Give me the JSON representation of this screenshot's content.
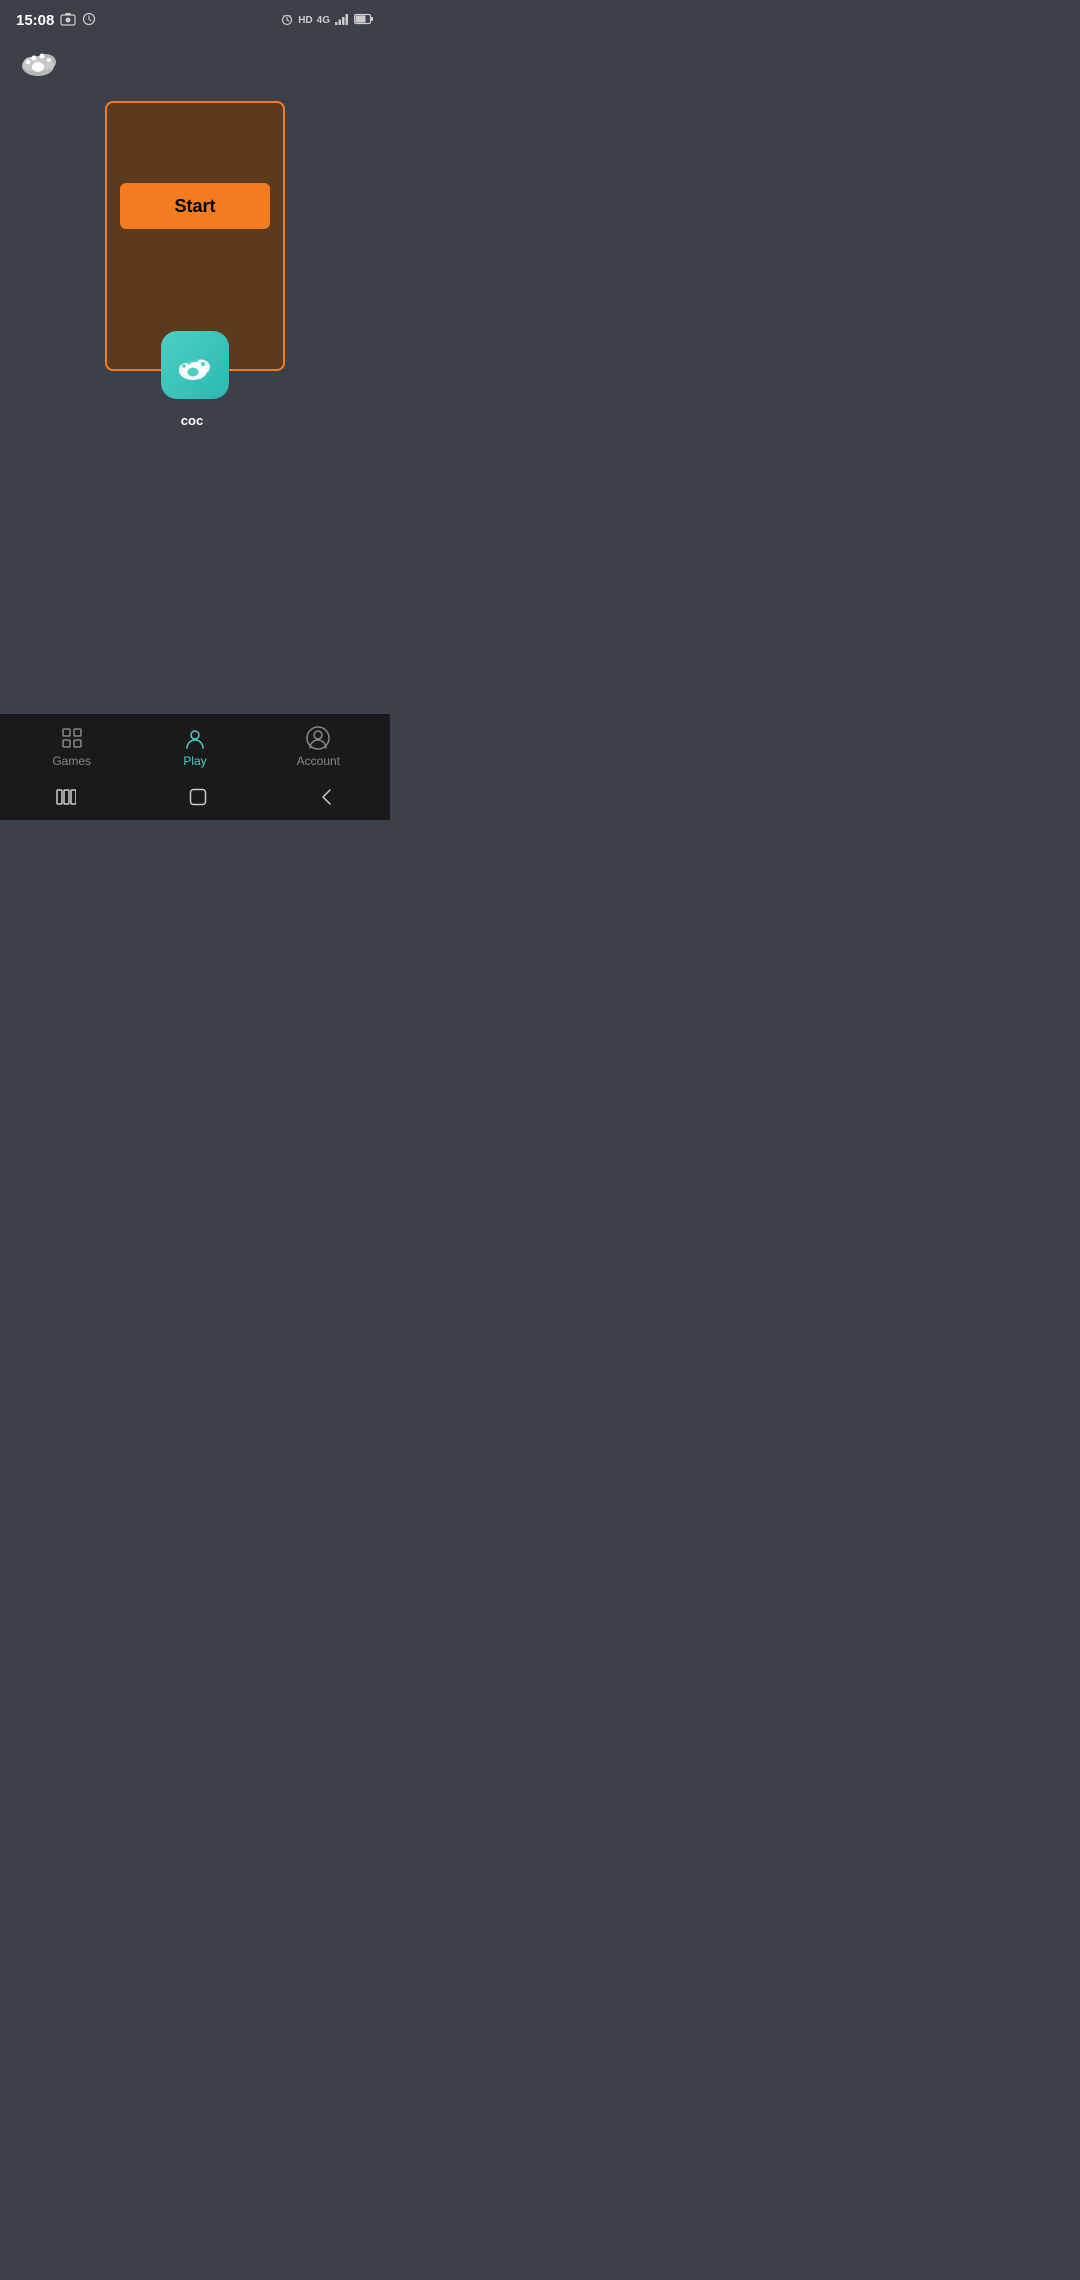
{
  "statusBar": {
    "time": "15:08",
    "icons": [
      "photo",
      "history"
    ],
    "rightIcons": [
      "alarm",
      "hd",
      "4g",
      "signal",
      "battery"
    ]
  },
  "header": {
    "appIconLabel": "paw-cloud"
  },
  "gameCard": {
    "startButtonLabel": "Start",
    "gameTitle": "coc",
    "borderColor": "#f47c20",
    "backgroundColor": "#5c3a1e"
  },
  "bottomNav": {
    "items": [
      {
        "id": "games",
        "label": "Games",
        "active": false
      },
      {
        "id": "play",
        "label": "Play",
        "active": true
      },
      {
        "id": "account",
        "label": "Account",
        "active": false
      }
    ]
  },
  "colors": {
    "accent": "#f47c20",
    "teal": "#4dd0c4",
    "background": "#3c4049",
    "navBackground": "#1a1a1a"
  }
}
